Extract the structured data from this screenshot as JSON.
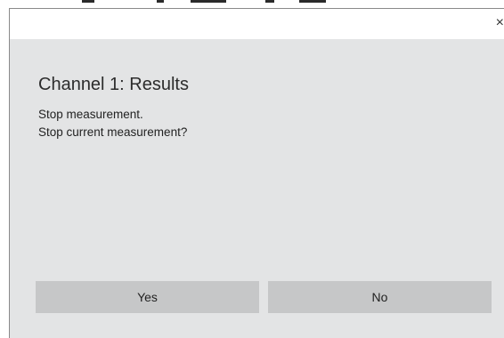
{
  "dialog": {
    "title": "Channel 1: Results",
    "message_line1": "Stop measurement.",
    "message_line2": "Stop current measurement?",
    "close_glyph": "×",
    "buttons": {
      "yes_label": "Yes",
      "no_label": "No"
    }
  },
  "colors": {
    "dialog_background": "#e3e4e5",
    "titlebar_background": "#ffffff",
    "button_background": "#c6c7c8"
  },
  "icons": {
    "close": "close-icon"
  }
}
